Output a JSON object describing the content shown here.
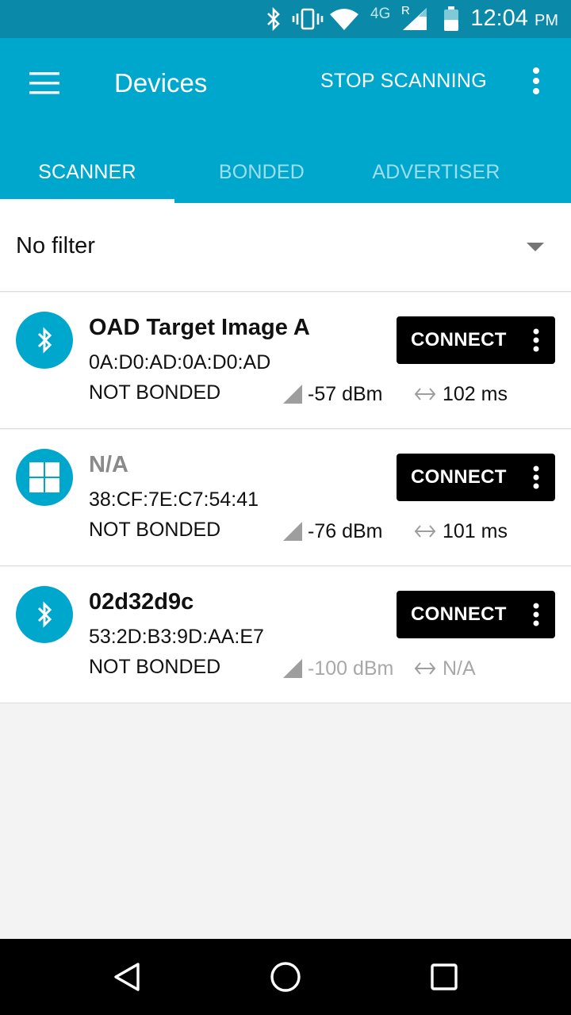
{
  "status_bar": {
    "time": "12:04",
    "ampm": "PM",
    "network": "4G",
    "roaming": "R",
    "icons": [
      "bluetooth-icon",
      "vibrate-icon",
      "wifi-icon",
      "signal-icon",
      "battery-icon"
    ]
  },
  "app_bar": {
    "title": "Devices",
    "action_label": "STOP SCANNING",
    "accent_color": "#00a7cc",
    "status_color": "#0a8aa8"
  },
  "tabs": [
    {
      "label": "SCANNER",
      "active": true
    },
    {
      "label": "BONDED",
      "active": false
    },
    {
      "label": "ADVERTISER",
      "active": false
    }
  ],
  "filter": {
    "label": "No filter"
  },
  "devices": [
    {
      "icon": "bluetooth-icon",
      "name": "OAD Target Image A",
      "address": "0A:D0:AD:0A:D0:AD",
      "bond_state": "NOT BONDED",
      "rssi": "-57 dBm",
      "interval": "102 ms",
      "connect_label": "CONNECT"
    },
    {
      "icon": "windows-icon",
      "name": "N/A",
      "address": "38:CF:7E:C7:54:41",
      "bond_state": "NOT BONDED",
      "rssi": "-76 dBm",
      "interval": "101 ms",
      "connect_label": "CONNECT"
    },
    {
      "icon": "bluetooth-icon",
      "name": "02d32d9c",
      "address": "53:2D:B3:9D:AA:E7",
      "bond_state": "NOT BONDED",
      "rssi": "-100 dBm",
      "interval": "N/A",
      "connect_label": "CONNECT"
    }
  ],
  "nav_bar": {
    "buttons": [
      "back-icon",
      "home-icon",
      "recents-icon"
    ]
  }
}
